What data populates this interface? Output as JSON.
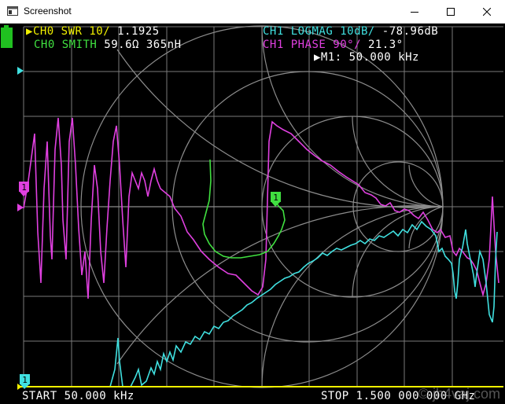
{
  "window": {
    "title": "Screenshot",
    "minimize_icon": "minimize-icon",
    "maximize_icon": "maximize-icon",
    "close_icon": "close-icon"
  },
  "colors": {
    "background": "#000000",
    "grid": "#808080",
    "ch0_swr": "#f0f000",
    "ch0_smith": "#40e040",
    "ch1_logmag": "#40e0e0",
    "ch1_phase": "#e040e0",
    "marker_text": "#ffffff"
  },
  "traces_header": {
    "ch0_swr": {
      "name": "CH0 SWR 10/",
      "value": "1.1925"
    },
    "ch0_smith": {
      "name": "CH0 SMITH",
      "value": "59.6Ω 365nH"
    },
    "ch1_logmag": {
      "name": "CH1 LOGMAG 10dB/",
      "value": "-78.96dB"
    },
    "ch1_phase": {
      "name": "CH1 PHASE 90°/",
      "value": "21.3°"
    },
    "active_marker": "▶M1: 50.000 kHz"
  },
  "marker_label": "1",
  "footer": {
    "start": "START 50.000 kHz",
    "stop": "STOP 1.500 000 000 GHz"
  },
  "watermark": "© jh4vaj.com"
}
